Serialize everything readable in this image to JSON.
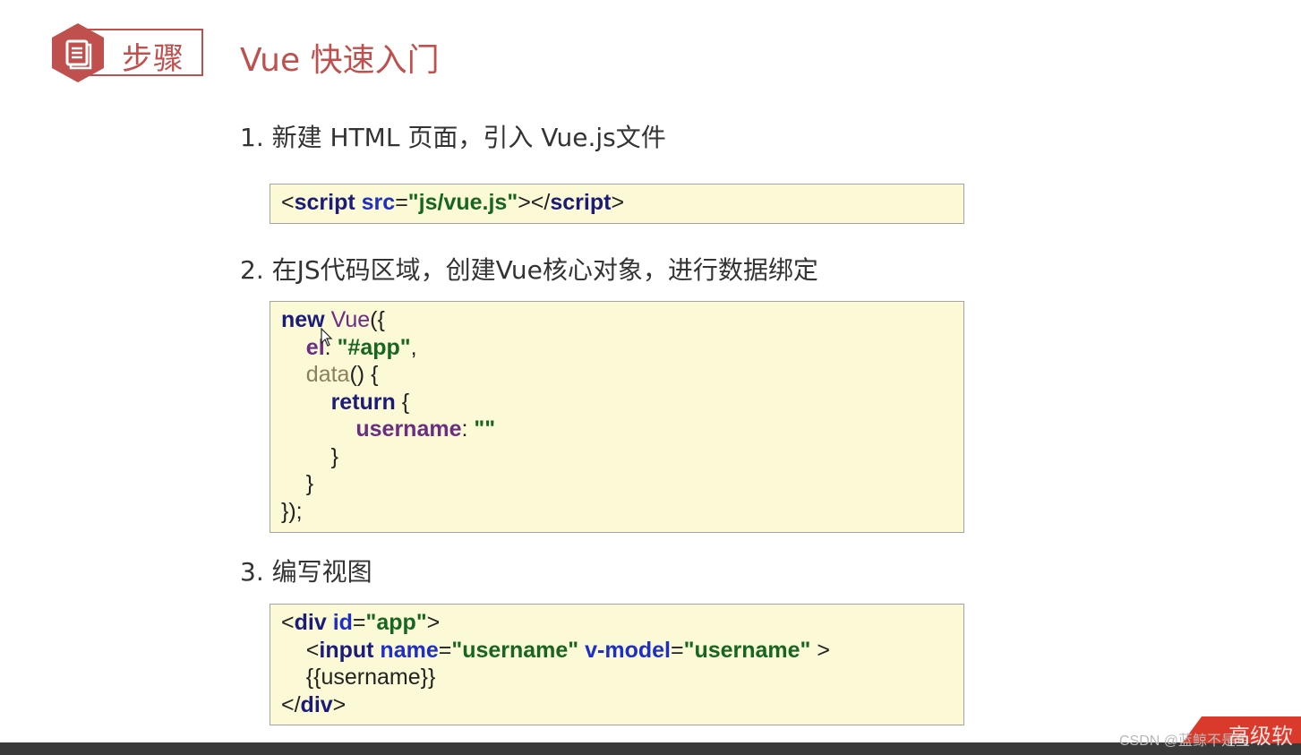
{
  "header": {
    "badge_label": "步骤",
    "badge_icon": "document-icon",
    "title": "Vue 快速入门",
    "accent_color": "#c0504d"
  },
  "steps": [
    {
      "label": "1. 新建 HTML 页面，引入 Vue.js文件",
      "code": [
        [
          [
            "p",
            "<"
          ],
          [
            "kw",
            "script "
          ],
          [
            "attr",
            "src"
          ],
          [
            "p",
            "="
          ],
          [
            "str",
            "\"js/vue.js\""
          ],
          [
            "p",
            "></"
          ],
          [
            "kw",
            "script"
          ],
          [
            "p",
            ">"
          ]
        ]
      ]
    },
    {
      "label": "2. 在JS代码区域，创建Vue核心对象，进行数据绑定",
      "code": [
        [
          [
            "kw",
            "new "
          ],
          [
            "fn",
            "Vue"
          ],
          [
            "p",
            "({"
          ]
        ],
        [
          [
            "p",
            "    "
          ],
          [
            "prop",
            "el"
          ],
          [
            "p",
            ": "
          ],
          [
            "str",
            "\"#app\""
          ],
          [
            "p",
            ","
          ]
        ],
        [
          [
            "p",
            "    "
          ],
          [
            "meth",
            "data"
          ],
          [
            "p",
            "() {"
          ]
        ],
        [
          [
            "p",
            "        "
          ],
          [
            "kw",
            "return"
          ],
          [
            "p",
            " {"
          ]
        ],
        [
          [
            "p",
            "            "
          ],
          [
            "prop",
            "username"
          ],
          [
            "p",
            ": "
          ],
          [
            "str",
            "\"\""
          ]
        ],
        [
          [
            "p",
            "        }"
          ]
        ],
        [
          [
            "p",
            "    }"
          ]
        ],
        [
          [
            "p",
            "});"
          ]
        ]
      ]
    },
    {
      "label": "3. 编写视图",
      "code": [
        [
          [
            "p",
            "<"
          ],
          [
            "kw",
            "div "
          ],
          [
            "attr",
            "id"
          ],
          [
            "p",
            "="
          ],
          [
            "str",
            "\"app\""
          ],
          [
            "p",
            ">"
          ]
        ],
        [
          [
            "p",
            "    <"
          ],
          [
            "kw",
            "input "
          ],
          [
            "attr",
            "name"
          ],
          [
            "p",
            "="
          ],
          [
            "str",
            "\"username\""
          ],
          [
            "p",
            " "
          ],
          [
            "attr",
            "v-model"
          ],
          [
            "p",
            "="
          ],
          [
            "str",
            "\"username\""
          ],
          [
            "p",
            " >"
          ]
        ],
        [
          [
            "p",
            "    {{username}}"
          ]
        ],
        [
          [
            "p",
            "</"
          ],
          [
            "kw",
            "div"
          ],
          [
            "p",
            ">"
          ]
        ]
      ]
    }
  ],
  "watermark": {
    "text": "CSDN @蓝鲸不是鱼",
    "seal": "高级软"
  }
}
